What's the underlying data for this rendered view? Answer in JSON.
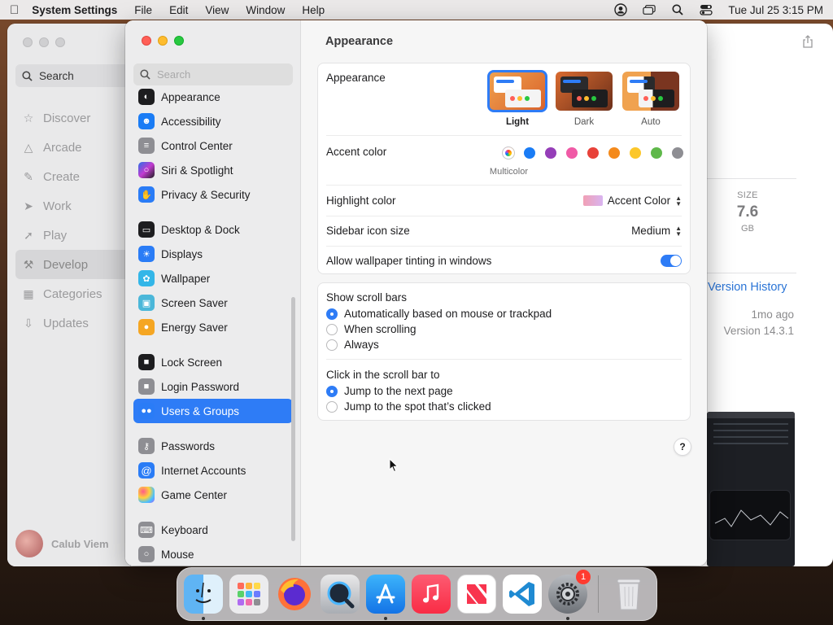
{
  "menubar": {
    "app_name": "System Settings",
    "menus": [
      "File",
      "Edit",
      "View",
      "Window",
      "Help"
    ],
    "clock": "Tue Jul 25  3:15 PM"
  },
  "background_app": {
    "search_label": "Search",
    "nav": [
      {
        "label": "Discover",
        "icon": "star-icon"
      },
      {
        "label": "Arcade",
        "icon": "joystick-icon"
      },
      {
        "label": "Create",
        "icon": "brush-icon"
      },
      {
        "label": "Work",
        "icon": "paper-plane-icon"
      },
      {
        "label": "Play",
        "icon": "rocket-icon"
      },
      {
        "label": "Develop",
        "icon": "hammer-icon"
      },
      {
        "label": "Categories",
        "icon": "grid-icon"
      },
      {
        "label": "Updates",
        "icon": "download-icon"
      }
    ],
    "active_nav": "Develop",
    "user_name": "Calub Viem",
    "size_label": "SIZE",
    "size_value": "7.6",
    "size_unit": "GB",
    "version_history": "Version History",
    "updated_ago": "1mo ago",
    "version": "Version 14.3.1"
  },
  "settings": {
    "search_placeholder": "Search",
    "sidebar_groups": [
      [
        {
          "label": "Appearance",
          "icon": "appearance-icon",
          "color": "#1d1d1f"
        },
        {
          "label": "Accessibility",
          "icon": "accessibility-icon",
          "color": "#1a7cf5"
        },
        {
          "label": "Control Center",
          "icon": "control-center-icon",
          "color": "#8e8e93"
        },
        {
          "label": "Siri & Spotlight",
          "icon": "siri-icon",
          "color": "#7a3ee0"
        },
        {
          "label": "Privacy & Security",
          "icon": "hand-icon",
          "color": "#2a7cf6"
        }
      ],
      [
        {
          "label": "Desktop & Dock",
          "icon": "dock-icon",
          "color": "#1d1d1f"
        },
        {
          "label": "Displays",
          "icon": "sun-icon",
          "color": "#2a7cf6"
        },
        {
          "label": "Wallpaper",
          "icon": "flower-icon",
          "color": "#33b6e8"
        },
        {
          "label": "Screen Saver",
          "icon": "screen-saver-icon",
          "color": "#4bb7d9"
        },
        {
          "label": "Energy Saver",
          "icon": "bulb-icon",
          "color": "#f5a623"
        }
      ],
      [
        {
          "label": "Lock Screen",
          "icon": "lock-icon",
          "color": "#1d1d1f"
        },
        {
          "label": "Login Password",
          "icon": "lock-icon",
          "color": "#8e8e93"
        },
        {
          "label": "Users & Groups",
          "icon": "users-icon",
          "color": "#2a7cf6"
        }
      ],
      [
        {
          "label": "Passwords",
          "icon": "key-icon",
          "color": "#8e8e93"
        },
        {
          "label": "Internet Accounts",
          "icon": "at-icon",
          "color": "#2a7cf6"
        },
        {
          "label": "Game Center",
          "icon": "game-center-icon",
          "color": "#ffffff"
        }
      ],
      [
        {
          "label": "Keyboard",
          "icon": "keyboard-icon",
          "color": "#8e8e93"
        },
        {
          "label": "Mouse",
          "icon": "mouse-icon",
          "color": "#8e8e93"
        }
      ]
    ],
    "selected_item": "Users & Groups",
    "title": "Appearance",
    "appearance": {
      "label": "Appearance",
      "options": [
        "Light",
        "Dark",
        "Auto"
      ],
      "selected": "Light"
    },
    "accent": {
      "label": "Accent color",
      "colors": [
        "multicolor",
        "#1a7cf5",
        "#953eb8",
        "#f05aa6",
        "#e8423a",
        "#f48a1c",
        "#fcc72a",
        "#5fb84a",
        "#8e8e93"
      ],
      "selected_name": "Multicolor"
    },
    "highlight": {
      "label": "Highlight color",
      "value": "Accent Color"
    },
    "sidebar_icon_size": {
      "label": "Sidebar icon size",
      "value": "Medium"
    },
    "wallpaper_tinting": {
      "label": "Allow wallpaper tinting in windows",
      "on": true
    },
    "scroll_bars": {
      "label": "Show scroll bars",
      "options": [
        "Automatically based on mouse or trackpad",
        "When scrolling",
        "Always"
      ],
      "selected": 0
    },
    "click_scroll": {
      "label": "Click in the scroll bar to",
      "options": [
        "Jump to the next page",
        "Jump to the spot that’s clicked"
      ],
      "selected": 0
    },
    "help_label": "?"
  },
  "dock": {
    "apps": [
      "Finder",
      "Launchpad",
      "Firefox",
      "QuickTime Player",
      "App Store",
      "Music",
      "News",
      "Visual Studio Code",
      "System Settings",
      "Trash"
    ],
    "badge": "1"
  }
}
